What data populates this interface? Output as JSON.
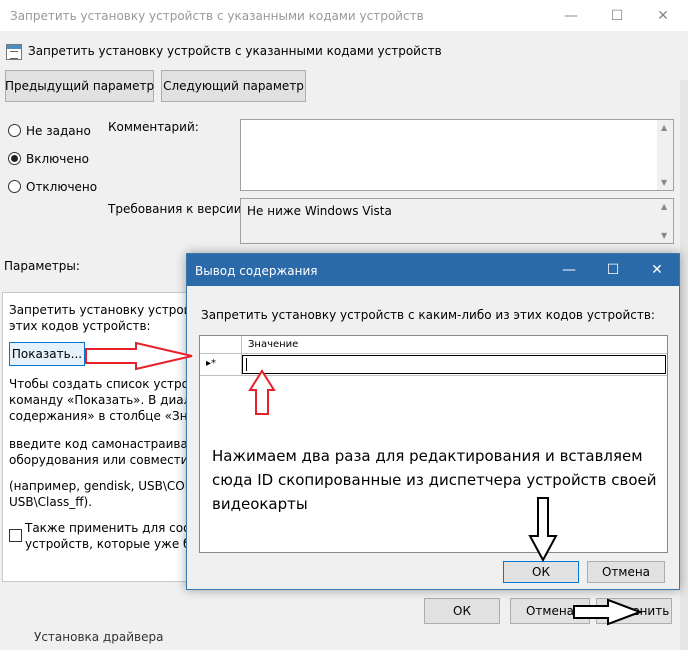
{
  "window": {
    "title": "Запретить установку устройств с указанными кодами устройств",
    "subtitle": "Запретить установку устройств с указанными кодами устройств"
  },
  "nav": {
    "prev_label": "Предыдущий параметр",
    "next_label": "Следующий параметр"
  },
  "state": {
    "options": [
      {
        "label": "Не задано",
        "selected": false
      },
      {
        "label": "Включено",
        "selected": true
      },
      {
        "label": "Отключено",
        "selected": false
      }
    ]
  },
  "comment_label": "Комментарий:",
  "version": {
    "label": "Требования к версии:",
    "value": "Не ниже Windows Vista"
  },
  "params": {
    "label": "Параметры:",
    "line1": "Запретить установку устройств с",
    "line2": "этих кодов устройств:",
    "show_button": "Показать...",
    "help1": "Чтобы создать список устройств,",
    "help2": "команду «Показать». В диалоговом",
    "help3": "содержания» в столбце «Значение»",
    "help4": "введите код самонастраивающегося",
    "help5": "оборудования или совместимый код",
    "help6": "(например, gendisk, USB\\COMPOSITE,",
    "help7": "USB\\Class_ff).",
    "also_apply1": "Также применить для соответствующих",
    "also_apply2": "устройств, которые уже были"
  },
  "footer": {
    "ok": "ОК",
    "cancel": "Отмена",
    "apply": "Применить",
    "background_text": "Установка драйвера"
  },
  "dialog": {
    "title": "Вывод содержания",
    "prompt": "Запретить установку устройств с каким-либо из этих кодов устройств:",
    "column_header": "Значение",
    "row_marker": "▸*",
    "ok": "ОК",
    "cancel": "Отмена"
  },
  "annotation": {
    "text": "Нажимаем два раза для редактирования и вставляем сюда ID скопированные из диспетчера устройств своей видеокарты"
  },
  "colors": {
    "dialog_title_bg": "#2b6aa8",
    "arrow_red": "#e8202a"
  }
}
